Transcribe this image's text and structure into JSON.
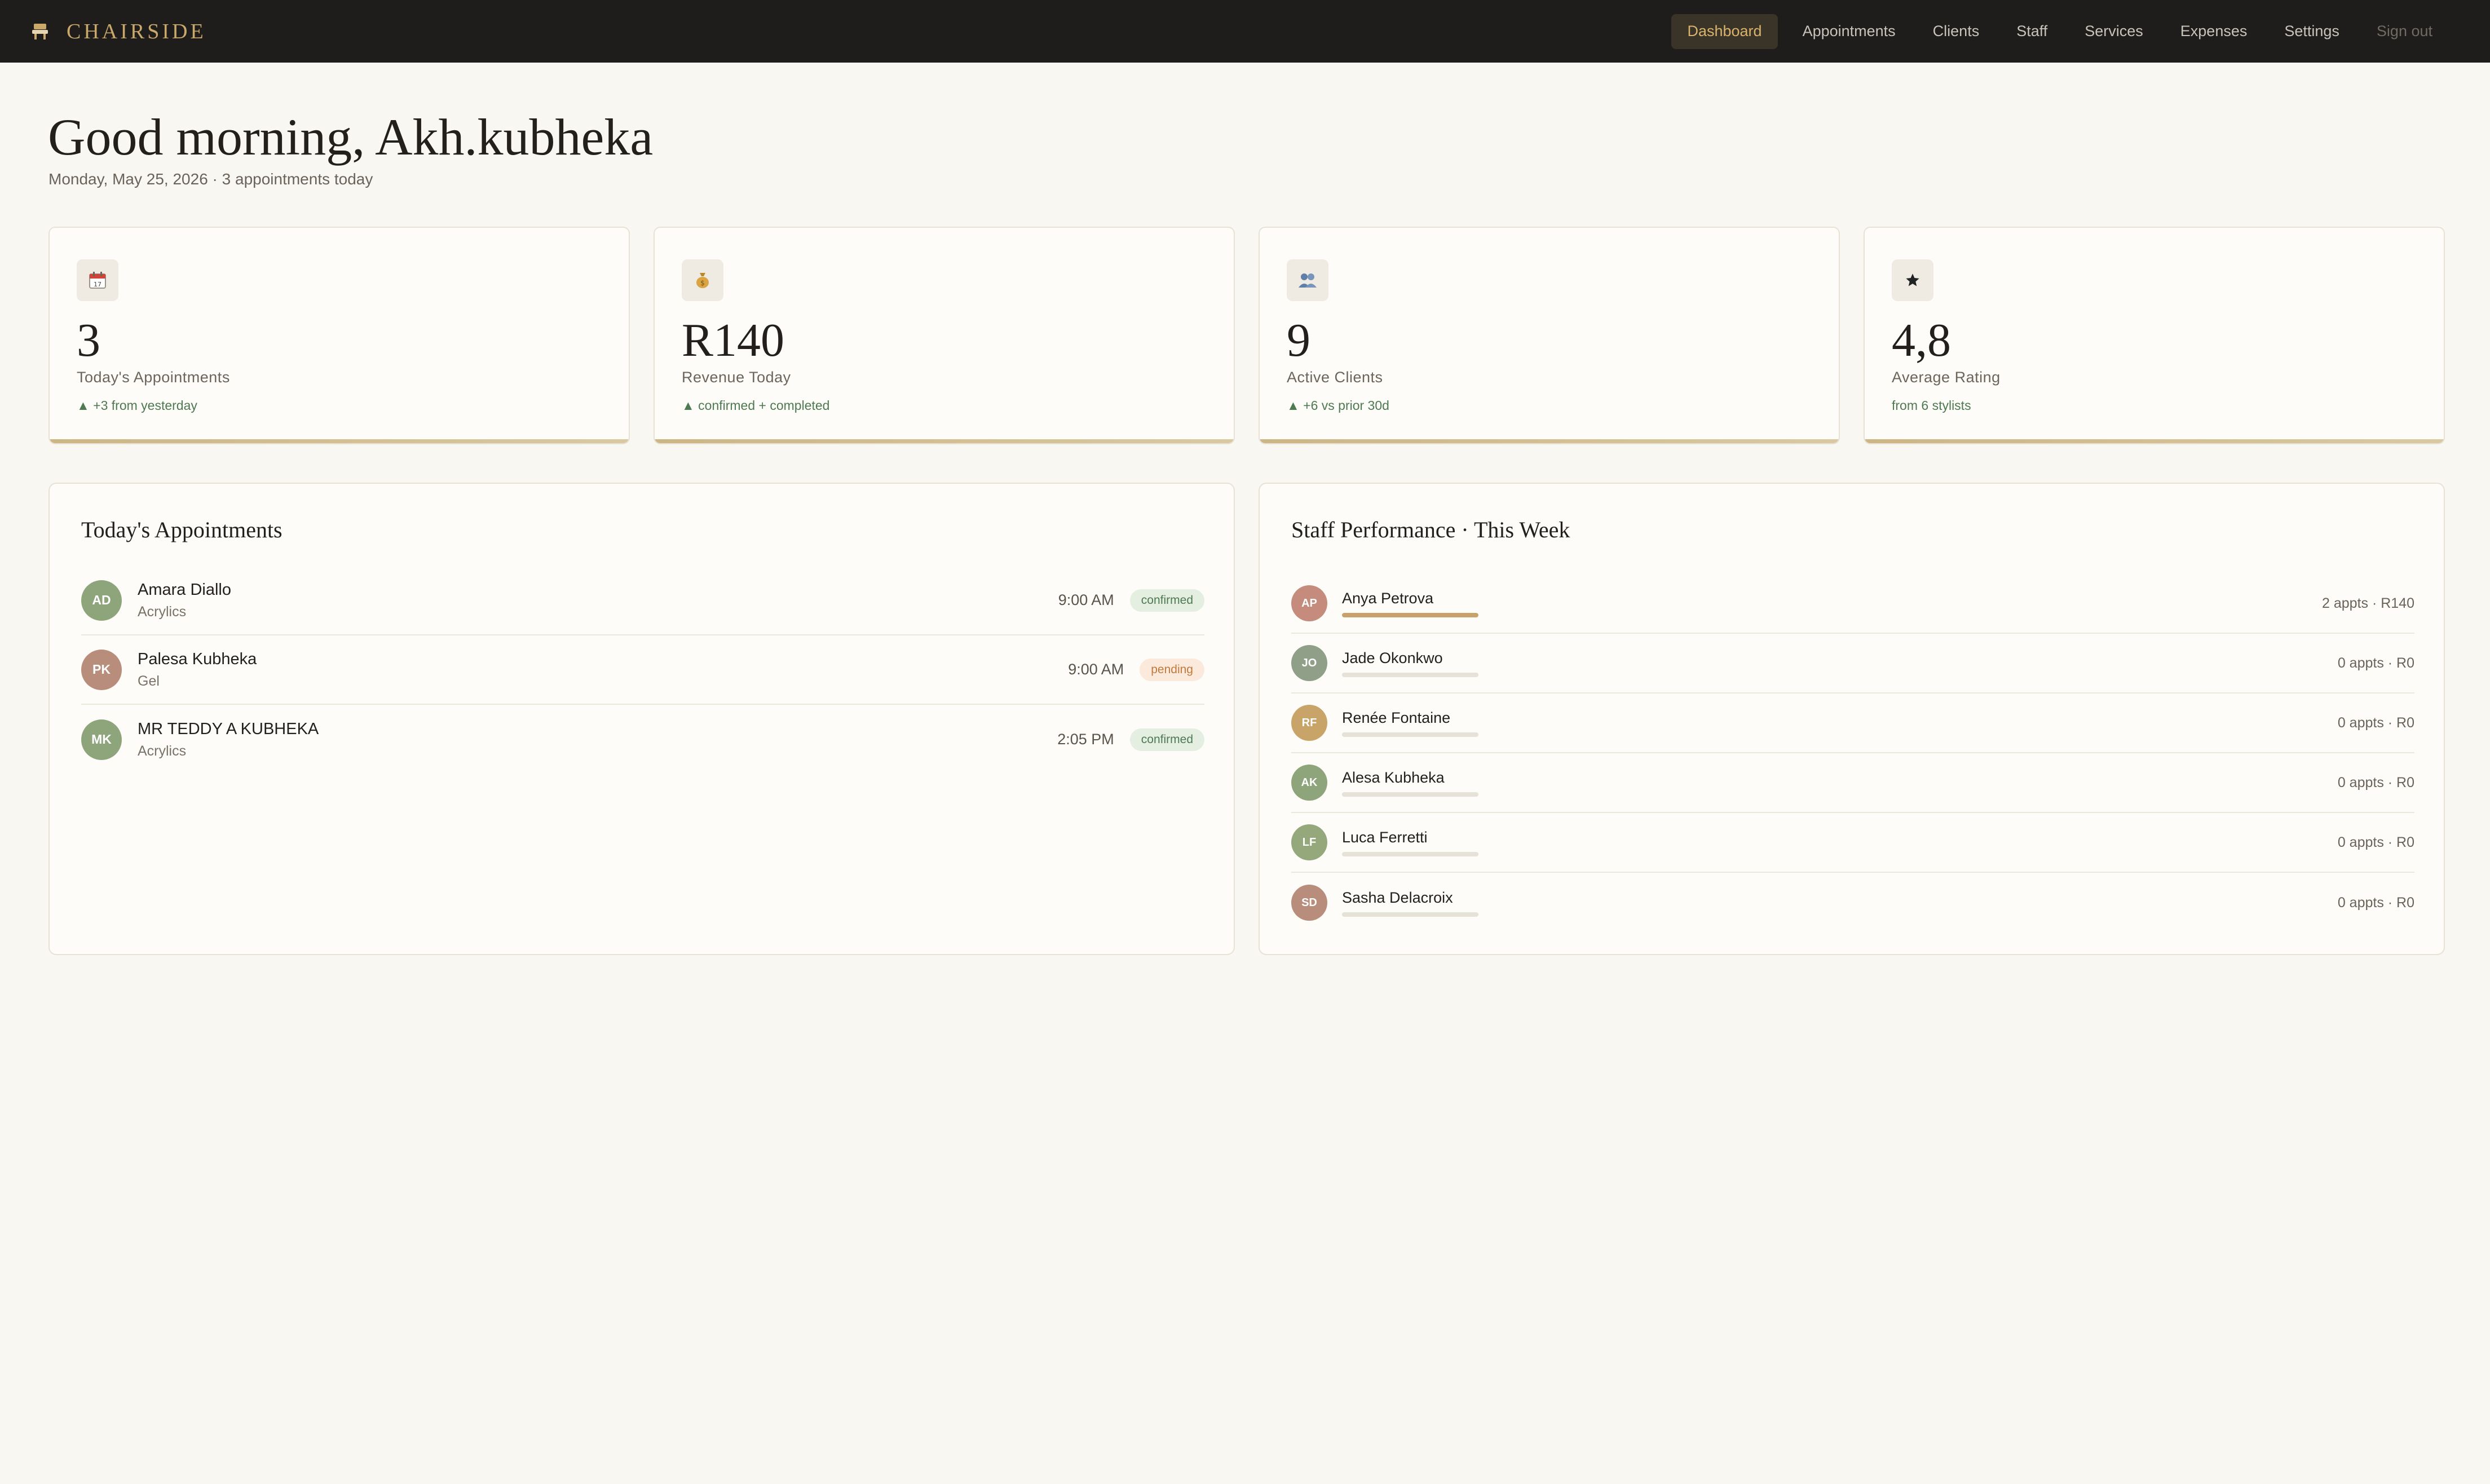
{
  "brand": {
    "name": "CHAIRSIDE",
    "icon": "chair-icon",
    "color": "#c9a86a"
  },
  "nav": {
    "items": [
      {
        "label": "Dashboard",
        "active": true
      },
      {
        "label": "Appointments"
      },
      {
        "label": "Clients"
      },
      {
        "label": "Staff"
      },
      {
        "label": "Services"
      },
      {
        "label": "Expenses"
      },
      {
        "label": "Settings"
      },
      {
        "label": "Sign out"
      }
    ]
  },
  "header": {
    "greeting": "Good morning, Akh.kubheka",
    "subline": "Monday, May 25, 2026 · 3 appointments today"
  },
  "stats": [
    {
      "icon": "calendar-icon",
      "glyph": "📅",
      "value": "3",
      "label": "Today's Appointments",
      "note": "▲ +3 from yesterday"
    },
    {
      "icon": "money-bag-icon",
      "glyph": "💰",
      "value": "R140",
      "label": "Revenue Today",
      "note": "▲ confirmed + completed"
    },
    {
      "icon": "people-icon",
      "glyph": "👥",
      "value": "9",
      "label": "Active Clients",
      "note": "▲ +6 vs prior 30d"
    },
    {
      "icon": "star-icon",
      "glyph": "★",
      "value": "4,8",
      "label": "Average Rating",
      "note": "from 6 stylists"
    }
  ],
  "appointments": {
    "title": "Today's Appointments",
    "rows": [
      {
        "initials": "AD",
        "name": "Amara Diallo",
        "service": "Acrylics",
        "time": "9:00 AM",
        "status": "confirmed",
        "color": "#8ea57c"
      },
      {
        "initials": "PK",
        "name": "Palesa Kubheka",
        "service": "Gel",
        "time": "9:00 AM",
        "status": "pending",
        "color": "#b98d7b"
      },
      {
        "initials": "MK",
        "name": "MR TEDDY A KUBHEKA",
        "service": "Acrylics",
        "time": "2:05 PM",
        "status": "confirmed",
        "color": "#8ea57c"
      }
    ]
  },
  "staff": {
    "title": "Staff Performance · This Week",
    "rows": [
      {
        "initials": "AP",
        "name": "Anya Petrova",
        "stat": "2 appts · R140",
        "progress": 1.0,
        "color": "#c58b7d"
      },
      {
        "initials": "JO",
        "name": "Jade Okonkwo",
        "stat": "0 appts · R0",
        "progress": 0,
        "color": "#8f9f88"
      },
      {
        "initials": "RF",
        "name": "Renée Fontaine",
        "stat": "0 appts · R0",
        "progress": 0,
        "color": "#c9a468"
      },
      {
        "initials": "AK",
        "name": "Alesa Kubheka",
        "stat": "0 appts · R0",
        "progress": 0,
        "color": "#8ea57c"
      },
      {
        "initials": "LF",
        "name": "Luca Ferretti",
        "stat": "0 appts · R0",
        "progress": 0,
        "color": "#94a87c"
      },
      {
        "initials": "SD",
        "name": "Sasha Delacroix",
        "stat": "0 appts · R0",
        "progress": 0,
        "color": "#b98d7b"
      }
    ]
  }
}
